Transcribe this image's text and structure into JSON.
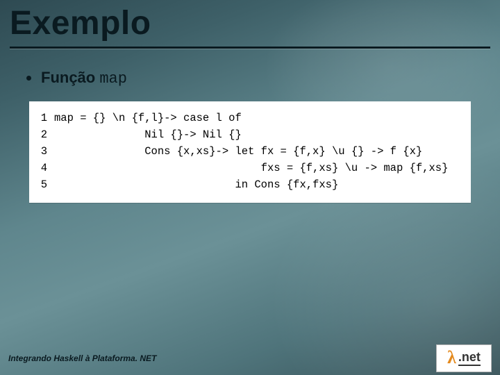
{
  "title": "Exemplo",
  "bullet": {
    "label": "Função",
    "code": "map"
  },
  "code": {
    "lines": [
      {
        "n": "1",
        "t": "map = {} \\n {f,l}-> case l of"
      },
      {
        "n": "2",
        "t": "              Nil {}-> Nil {}"
      },
      {
        "n": "3",
        "t": "              Cons {x,xs}-> let fx = {f,x} \\u {} -> f {x}"
      },
      {
        "n": "4",
        "t": "                                fxs = {f,xs} \\u -> map {f,xs}"
      },
      {
        "n": "5",
        "t": "                            in Cons {fx,fxs}"
      }
    ]
  },
  "footer": "Integrando Haskell à Plataforma. NET",
  "logo": {
    "lambda": "λ",
    "text": ".net"
  }
}
